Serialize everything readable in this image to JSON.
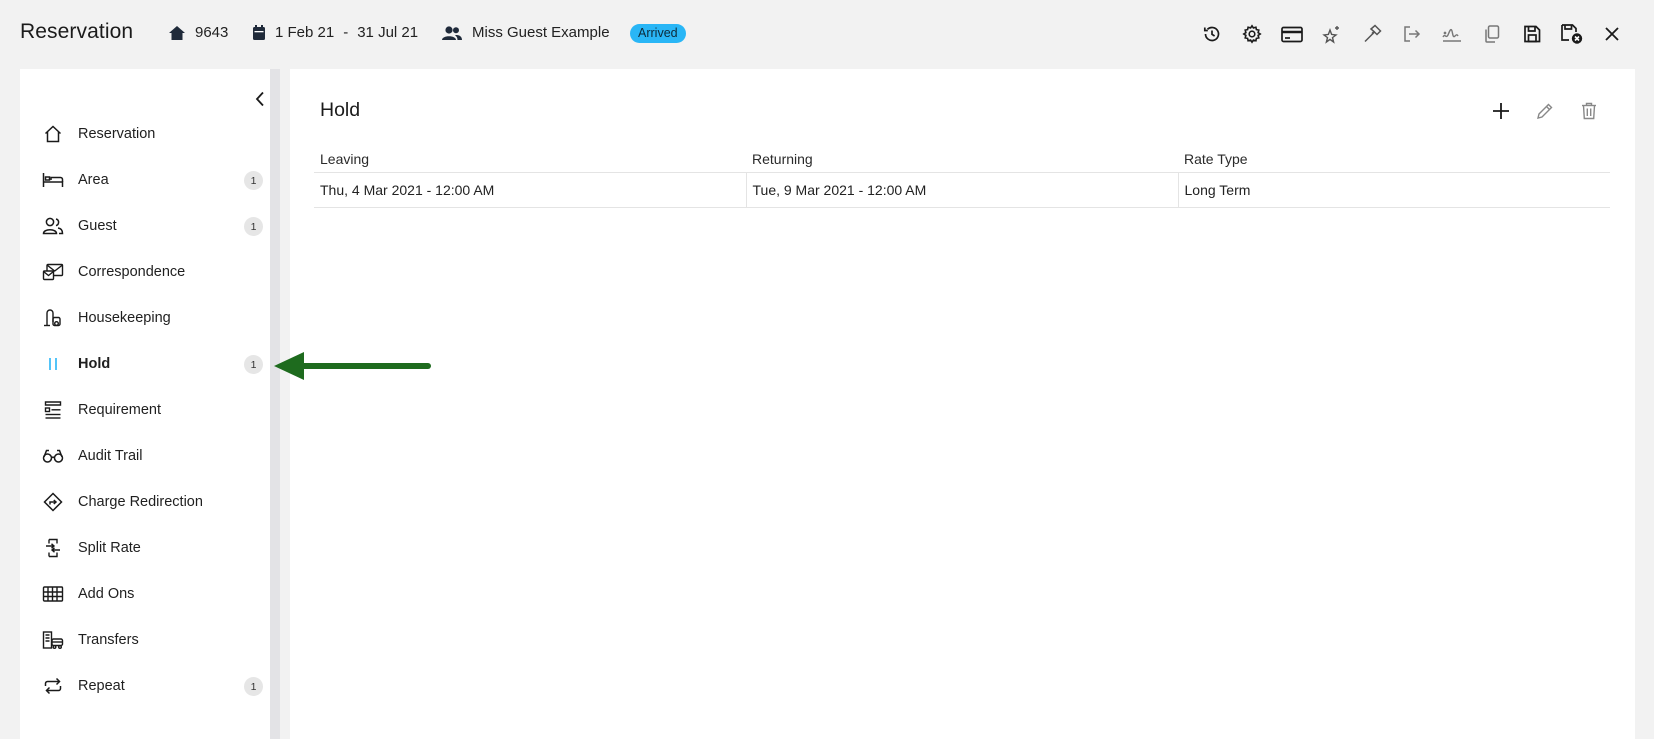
{
  "header": {
    "title": "Reservation",
    "area_number": "9643",
    "date_from": "1 Feb 21",
    "date_separator": "-",
    "date_to": "31 Jul 21",
    "guest_name": "Miss Guest Example",
    "status": "Arrived",
    "status_color": "#29b6f6",
    "toolbar_icons": [
      "history-icon",
      "settings-gear-icon",
      "credit-card-icon",
      "sparkle-star-icon",
      "hammer-icon",
      "exit-icon",
      "signature-icon",
      "copy-icon",
      "save-icon",
      "save-close-icon",
      "close-icon"
    ]
  },
  "sidebar": {
    "items": [
      {
        "label": "Reservation",
        "icon": "home-icon",
        "count": ""
      },
      {
        "label": "Area",
        "icon": "bed-icon",
        "count": "1"
      },
      {
        "label": "Guest",
        "icon": "users-icon",
        "count": "1"
      },
      {
        "label": "Correspondence",
        "icon": "envelope-icon",
        "count": ""
      },
      {
        "label": "Housekeeping",
        "icon": "vacuum-icon",
        "count": ""
      },
      {
        "label": "Hold",
        "icon": "pause-icon",
        "count": "1",
        "active": true
      },
      {
        "label": "Requirement",
        "icon": "checklist-icon",
        "count": ""
      },
      {
        "label": "Audit Trail",
        "icon": "glasses-icon",
        "count": ""
      },
      {
        "label": "Charge Redirection",
        "icon": "direction-sign-icon",
        "count": ""
      },
      {
        "label": "Split Rate",
        "icon": "split-icon",
        "count": ""
      },
      {
        "label": "Add Ons",
        "icon": "grid-icon",
        "count": ""
      },
      {
        "label": "Transfers",
        "icon": "transfer-bus-icon",
        "count": ""
      },
      {
        "label": "Repeat",
        "icon": "repeat-icon",
        "count": "1"
      }
    ],
    "active_color": "#29b6f6"
  },
  "panel": {
    "title": "Hold",
    "columns": [
      "Leaving",
      "Returning",
      "Rate Type"
    ],
    "rows": [
      [
        "Thu, 4 Mar 2021 - 12:00 AM",
        "Tue, 9 Mar 2021 - 12:00 AM",
        "Long Term"
      ]
    ]
  },
  "annotation": {
    "arrow_color": "#1e6b1e"
  }
}
